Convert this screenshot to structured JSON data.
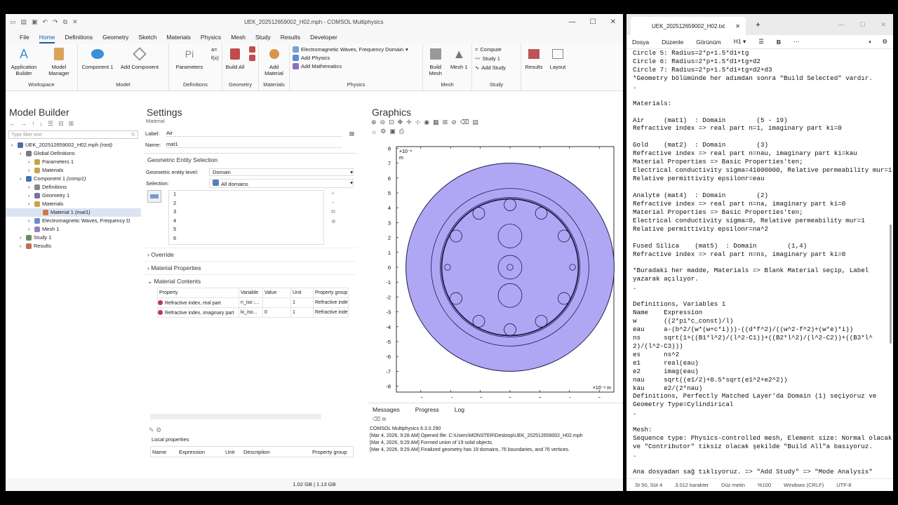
{
  "comsol": {
    "title": "UEK_202512659002_H02.mph - COMSOL Multiphysics",
    "menu": [
      "File",
      "Home",
      "Definitions",
      "Geometry",
      "Sketch",
      "Materials",
      "Physics",
      "Mesh",
      "Study",
      "Results",
      "Developer"
    ],
    "ribbon": {
      "workspace": {
        "label": "Workspace",
        "app_builder": "Application Builder",
        "model_manager": "Model Manager"
      },
      "model": {
        "label": "Model",
        "component": "Component 1",
        "add_component": "Add Component"
      },
      "definitions": {
        "label": "Definitions",
        "parameters": "Parameters"
      },
      "geometry": {
        "label": "Geometry",
        "build_all": "Build All"
      },
      "materials": {
        "label": "Materials",
        "add_material": "Add Material"
      },
      "physics": {
        "label": "Physics",
        "interface": "Electromagnetic Waves, Frequency Domain",
        "add_physics": "Add Physics",
        "add_math": "Add Mathematics"
      },
      "mesh": {
        "label": "Mesh",
        "build_mesh": "Build Mesh",
        "mesh1": "Mesh 1"
      },
      "study": {
        "label": "Study",
        "compute": "Compute",
        "study1": "Study 1",
        "add_study": "Add Study"
      },
      "results_layout": {
        "results": "Results",
        "layout": "Layout"
      }
    },
    "model_builder": {
      "title": "Model Builder",
      "filter_placeholder": "Type filter text",
      "tree": [
        {
          "label": "UEK_202512659002_H02.mph",
          "suffix": "(root)",
          "level": 0,
          "color": "#4a6fa5"
        },
        {
          "label": "Global Definitions",
          "suffix": "",
          "level": 1,
          "color": "#7a7a7a"
        },
        {
          "label": "Parameters 1",
          "suffix": "",
          "level": 2,
          "color": "#c9a24a"
        },
        {
          "label": "Materials",
          "suffix": "",
          "level": 2,
          "color": "#c9a24a"
        },
        {
          "label": "Component 1",
          "suffix": "(comp1)",
          "level": 1,
          "color": "#3d73b8"
        },
        {
          "label": "Definitions",
          "suffix": "",
          "level": 2,
          "color": "#888888"
        },
        {
          "label": "Geometry 1",
          "suffix": "",
          "level": 2,
          "color": "#7b6fa8"
        },
        {
          "label": "Materials",
          "suffix": "",
          "level": 2,
          "color": "#c9a24a"
        },
        {
          "label": "Material 1",
          "suffix": "(mat1)",
          "level": 3,
          "color": "#c97a4a"
        },
        {
          "label": "Electromagnetic Waves, Frequency D",
          "suffix": "",
          "level": 2,
          "color": "#6b8fbf"
        },
        {
          "label": "Mesh 1",
          "suffix": "",
          "level": 2,
          "color": "#9a7fbf"
        },
        {
          "label": "Study 1",
          "suffix": "",
          "level": 1,
          "color": "#6a8a6a"
        },
        {
          "label": "Results",
          "suffix": "",
          "level": 1,
          "color": "#c07050"
        }
      ]
    },
    "settings": {
      "title": "Settings",
      "subtitle": "Material",
      "label_caption": "Label:",
      "label_value": "Air",
      "name_caption": "Name:",
      "name_value": "mat1",
      "ges_title": "Geometric Entity Selection",
      "entity_level_caption": "Geometric entity level:",
      "entity_level": "Domain",
      "selection_caption": "Selection:",
      "selection_value": "All domains",
      "domains": [
        "1",
        "2",
        "3",
        "4",
        "5",
        "6"
      ],
      "override": "Override",
      "mat_props": "Material Properties",
      "mat_contents": "Material Contents",
      "table_headers": [
        "Property",
        "Variable",
        "Value",
        "Unit",
        "Property group"
      ],
      "table_rows": [
        [
          "Refractive index, real part",
          "n_iso ;...",
          "",
          "1",
          "Refractive inde"
        ],
        [
          "Refractive index, imaginary part",
          "ki_iso...",
          "0",
          "1",
          "Refractive inde"
        ]
      ],
      "local_props": "Local properties",
      "local_headers": [
        "Name",
        "Expression",
        "Unit",
        "Description",
        "Property group"
      ]
    },
    "graphics": {
      "title": "Graphics",
      "y_exp": "×10⁻⁶",
      "y_unit": "m",
      "x_exp": "×10⁻⁶ m",
      "y_ticks": [
        "8",
        "7",
        "6",
        "5",
        "4",
        "3",
        "2",
        "1",
        "0",
        "-1",
        "-2",
        "-3",
        "-4",
        "-5",
        "-6",
        "-7",
        "-8"
      ],
      "x_ticks": [
        "-6",
        "-4",
        "-2",
        "0",
        "2",
        "4",
        "6"
      ]
    },
    "messages": {
      "tabs": [
        "Messages",
        "Progress",
        "Log"
      ],
      "lines": [
        "COMSOL Multiphysics 6.3.0.290",
        "[Mar 4, 2026, 9:28 AM] Opened file: C:\\Users\\MONSTER\\Desktop\\UEK_202512659002_H02.mph",
        "[Mar 4, 2026, 9:29 AM] Formed union of 19 solid objects.",
        "[Mar 4, 2026, 9:29 AM] Finalized geometry has 19 domains, 76 boundaries, and 76 vertices."
      ]
    },
    "status": "1.02 GB | 1.13 GB"
  },
  "notepad": {
    "tab_title": "UEK_202512659002_H02.txt",
    "menu": [
      "Dosya",
      "Düzenle",
      "Görünüm",
      "H1"
    ],
    "lines": [
      "Circle 5: Radius=2*p+1.5*d1+tg",
      "Circle 6: Radius=2*p+1.5*d1+tg+d2",
      "Circle 7: Radius=2*p+1.5*d1+tg+d2+d3",
      "*Geometry bölümünde her adımdan sonra \"Build Selected\" vardır.",
      ".",
      "",
      "Materials:",
      "",
      "Air     (mat1)  : Domain        (5 - 19)",
      "Refractive index => real part n=1, imaginary part ki=0",
      "",
      "Gold    (mat2)  : Domain        (3)",
      "Refractive index => real part n=nau, imaginary part ki=kau",
      "Material Properties => Basic Properties'ten;",
      "Electrical conductivity sigma=41000000, Relative permeability mur=1",
      "Relative permittivity epsilonr=eau",
      "",
      "Analyte (mat4)  : Domain        (2)",
      "Refractive index => real part n=na, imaginary part ki=0",
      "Material Properties => Basic Properties'ten;",
      "Electrical conductivity sigma=0, Relative permeability mur=1",
      "Relative permittivity epsilonr=na^2",
      "",
      "Fused Silica    (mat5)  : Domain        (1,4)",
      "Refractive index => real part n=ns, imaginary part ki=0",
      "",
      "*Buradaki her madde, Materials => Blank Material seçip, Label",
      "yazarak açılıyor.",
      ".",
      "",
      "Definitions, Variables 1",
      "Name    Expression",
      "w       ((2*pi*c_const)/l)",
      "eau     a-(b^2/(w*(w+c*i)))-((d*f^2)/((w^2-f^2)+(w*e)*i))",
      "ns      sqrt(1+((B1*l^2)/(l^2-C1))+((B2*l^2)/(l^2-C2))+((B3*l^",
      "2)/(l^2-C3)))",
      "es      ns^2",
      "e1      real(eau)",
      "e2      imag(eau)",
      "nau     sqrt((e1/2)+0.5*sqrt(e1^2+e2^2))",
      "kau     e2/(2*nau)",
      "Definitions, Perfectly Matched Layer'da Domain (1) seçiyoruz ve",
      "Geometry Type=Cylindirical",
      ".",
      "",
      "Mesh:",
      "Sequence type: Physics-controlled mesh, Element size: Normal olacak",
      "ve \"Contributor\" tiksiz olacak şekilde \"Build All\"a basıyoruz.",
      ".",
      "",
      "Ana dosyadan sağ tıklıyoruz. => \"Add Study\" => \"Mode Analysis\""
    ],
    "status": [
      "St 50, Süt 4",
      "3.012 karakter",
      "Düz metin",
      "%100",
      "Windows (CRLF)",
      "UTF-8"
    ]
  }
}
